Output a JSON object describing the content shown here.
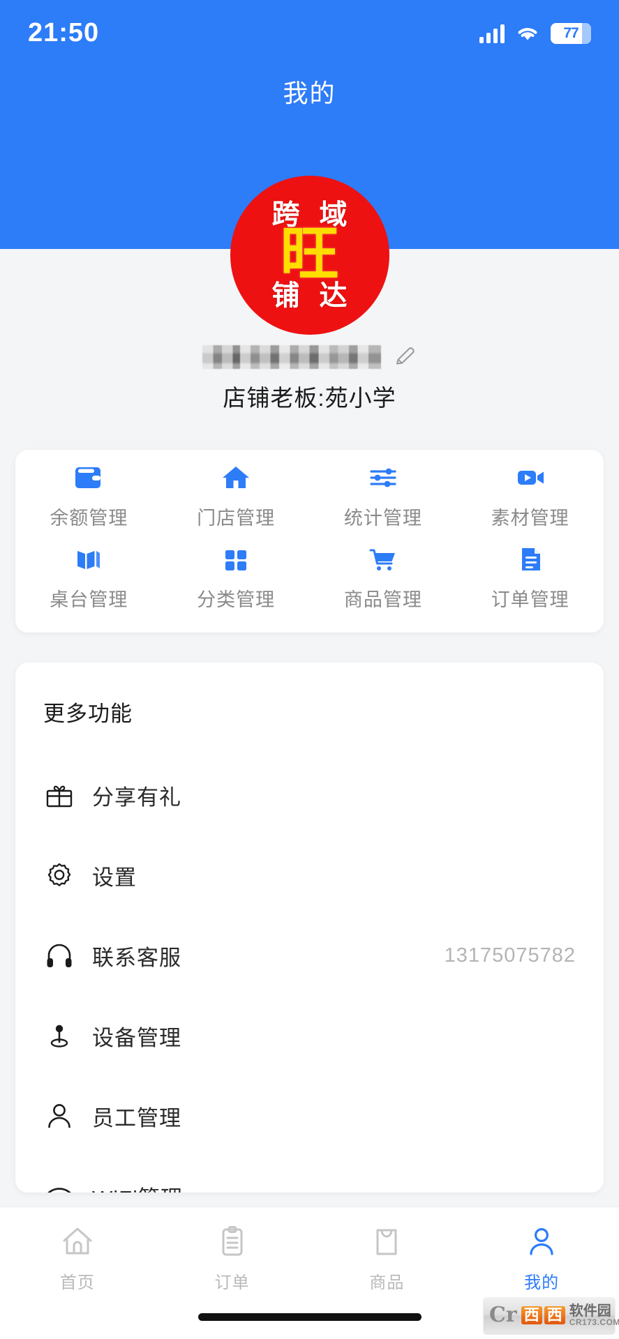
{
  "status_bar": {
    "time": "21:50",
    "battery_level": "77",
    "signal_icon": "signal-bars-icon",
    "wifi_icon": "wifi-icon",
    "battery_icon": "battery-icon"
  },
  "header": {
    "title": "我的",
    "background_color": "#2d7cf8"
  },
  "profile": {
    "logo": {
      "top_text": "跨域",
      "center_text": "旺",
      "bottom_text": "铺达",
      "circle_color": "#ee1111",
      "center_color": "#ffdd00",
      "text_color": "#ffffff"
    },
    "username_masked": "",
    "edit_icon": "pencil-edit-icon",
    "owner_line": "店铺老板:苑小学"
  },
  "quick_grid": {
    "items": [
      {
        "label": "余额管理",
        "icon": "wallet-icon"
      },
      {
        "label": "门店管理",
        "icon": "house-icon"
      },
      {
        "label": "统计管理",
        "icon": "sliders-icon"
      },
      {
        "label": "素材管理",
        "icon": "video-camera-icon"
      },
      {
        "label": "桌台管理",
        "icon": "map-folded-icon"
      },
      {
        "label": "分类管理",
        "icon": "grid-squares-icon"
      },
      {
        "label": "商品管理",
        "icon": "shopping-cart-icon"
      },
      {
        "label": "订单管理",
        "icon": "document-icon"
      }
    ],
    "icon_color": "#2d7cf8",
    "label_color": "#8a8a8a"
  },
  "more_functions": {
    "title": "更多功能",
    "rows": [
      {
        "label": "分享有礼",
        "icon": "gift-icon",
        "value": ""
      },
      {
        "label": "设置",
        "icon": "gear-icon",
        "value": ""
      },
      {
        "label": "联系客服",
        "icon": "headphones-icon",
        "value": "13175075782"
      },
      {
        "label": "设备管理",
        "icon": "location-pin-icon",
        "value": ""
      },
      {
        "label": "员工管理",
        "icon": "person-icon",
        "value": ""
      },
      {
        "label": "WiFi管理",
        "icon": "wifi-manage-icon",
        "value": ""
      }
    ]
  },
  "tabbar": {
    "active_color": "#2d7cf8",
    "inactive_color": "#b9b9b9",
    "tabs": [
      {
        "label": "首页",
        "icon": "home-icon",
        "active": false
      },
      {
        "label": "订单",
        "icon": "clipboard-icon",
        "active": false
      },
      {
        "label": "商品",
        "icon": "shopping-bag-icon",
        "active": false
      },
      {
        "label": "我的",
        "icon": "person-icon",
        "active": true
      }
    ]
  },
  "watermark": {
    "mark": "Cr",
    "cn1": "西",
    "cn2": "西",
    "cn_name": "软件园",
    "domain": "CR173.COM"
  }
}
